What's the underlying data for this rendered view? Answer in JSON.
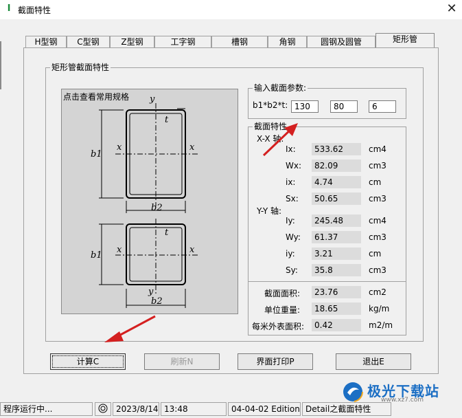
{
  "window": {
    "title": "截面特性",
    "app_icon": "I",
    "close_glyph": "✕"
  },
  "tabs": [
    {
      "label": "H型钢",
      "active": false
    },
    {
      "label": "C型钢",
      "active": false
    },
    {
      "label": "Z型钢",
      "active": false
    },
    {
      "label": "工字钢",
      "active": false
    },
    {
      "label": "槽钢",
      "active": false
    },
    {
      "label": "角钢",
      "active": false
    },
    {
      "label": "圆钢及圆管",
      "active": false
    },
    {
      "label": "矩形管",
      "active": true
    }
  ],
  "section": {
    "group_title": "矩形管截面特性",
    "diagram_caption": "点击查看常用规格",
    "diagram_labels": {
      "y": "y",
      "x": "x",
      "t": "t",
      "b1": "b1",
      "b2": "b2"
    }
  },
  "input": {
    "group_title": "输入截面参数:",
    "label": "b1*b2*t:",
    "values": [
      "130",
      "80",
      "6"
    ]
  },
  "properties": {
    "group_title": "截面特性",
    "xx_axis_label": "X-X 轴:",
    "yy_axis_label": "Y-Y 轴:",
    "xx": [
      {
        "label": "Ix:",
        "value": "533.62",
        "unit": "cm4"
      },
      {
        "label": "Wx:",
        "value": "82.09",
        "unit": "cm3"
      },
      {
        "label": "ix:",
        "value": "4.74",
        "unit": "cm"
      },
      {
        "label": "Sx:",
        "value": "50.65",
        "unit": "cm3"
      }
    ],
    "yy": [
      {
        "label": "Iy:",
        "value": "245.48",
        "unit": "cm4"
      },
      {
        "label": "Wy:",
        "value": "61.37",
        "unit": "cm3"
      },
      {
        "label": "iy:",
        "value": "3.21",
        "unit": "cm"
      },
      {
        "label": "Sy:",
        "value": "35.8",
        "unit": "cm3"
      }
    ],
    "extra": [
      {
        "label": "截面面积:",
        "value": "23.76",
        "unit": "cm2"
      },
      {
        "label": "单位重量:",
        "value": "18.65",
        "unit": "kg/m"
      },
      {
        "label": "每米外表面积:",
        "value": "0.42",
        "unit": "m2/m"
      }
    ]
  },
  "buttons": {
    "calculate": "计算C",
    "refresh": "刷新N",
    "print": "界面打印P",
    "exit": "退出E"
  },
  "statusbar": {
    "status": "程序运行中...",
    "date": "2023/8/14",
    "time": "13:48",
    "version": "04-04-02 Edition",
    "detail": "Detail之截面特性"
  },
  "watermark": {
    "text": "极光下载站",
    "subtext": "www.xz7.com"
  },
  "colors": {
    "accent": "#d42020",
    "watermark_blue": "#1c6fc4"
  }
}
